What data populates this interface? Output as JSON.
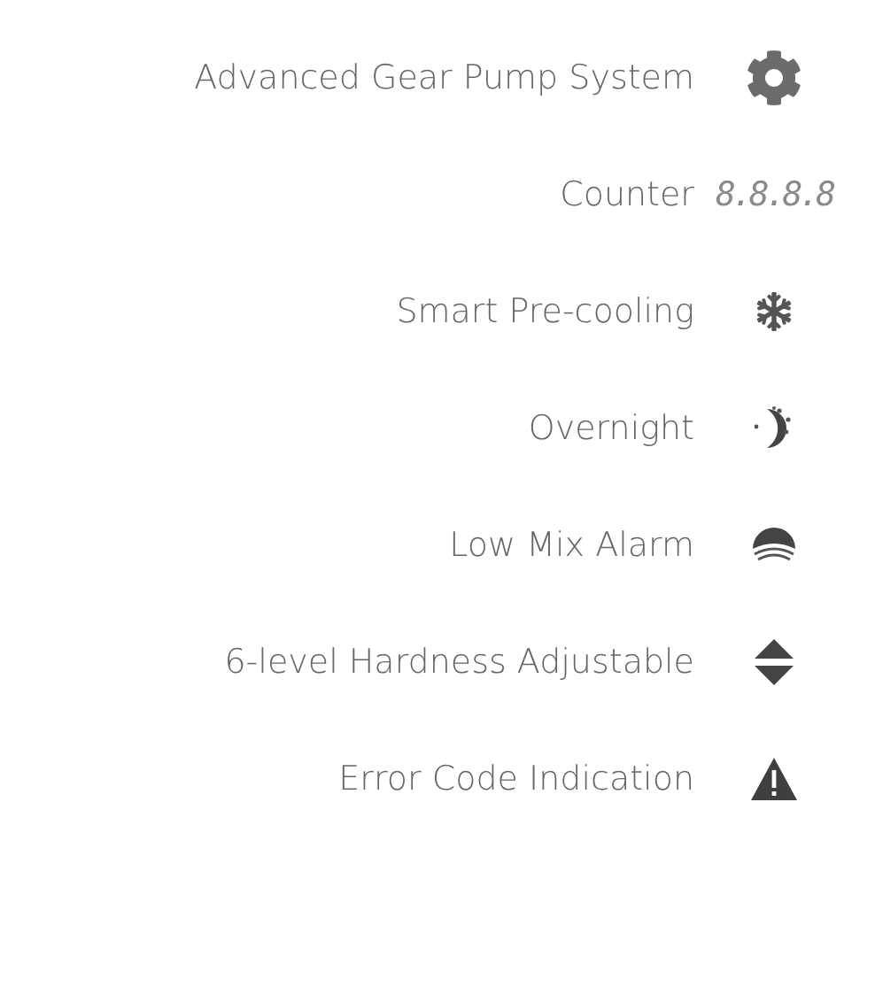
{
  "features": [
    {
      "label": "Advanced Gear Pump System",
      "kind": "gear"
    },
    {
      "label": "Counter",
      "kind": "display",
      "display": "8.8.8.8"
    },
    {
      "label": "Smart Pre-cooling",
      "kind": "snowflake"
    },
    {
      "label": "Overnight",
      "kind": "moon"
    },
    {
      "label": "Low Mix Alarm",
      "kind": "dome"
    },
    {
      "label": "6-level Hardness Adjustable",
      "kind": "updown"
    },
    {
      "label": "Error Code Indication",
      "kind": "warning"
    }
  ]
}
